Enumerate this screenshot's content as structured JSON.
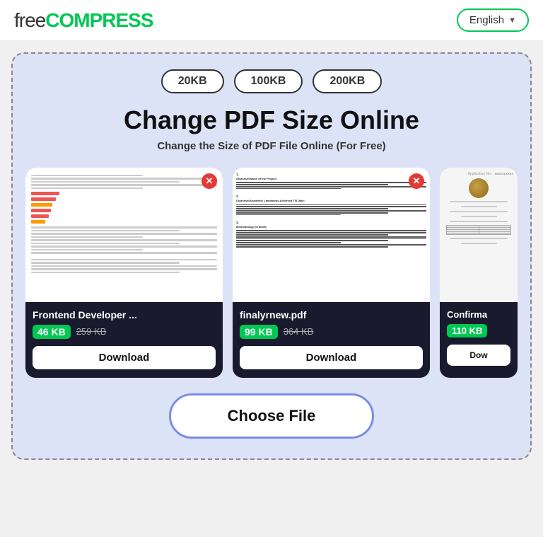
{
  "header": {
    "logo_free": "free",
    "logo_compress": "COMPRESS",
    "lang_label": "English",
    "lang_arrow": "▼"
  },
  "size_pills": [
    "20KB",
    "100KB",
    "200KB"
  ],
  "main_title": "Change PDF Size Online",
  "sub_title": "Change the Size of PDF File Online (For Free)",
  "cards": [
    {
      "filename": "Frontend Developer ...",
      "new_size": "46 KB",
      "old_size": "259 KB",
      "download_label": "Download"
    },
    {
      "filename": "finalyrnew.pdf",
      "new_size": "99 KB",
      "old_size": "364 KB",
      "download_label": "Download"
    },
    {
      "filename": "Confirma",
      "new_size": "110 KB",
      "old_size": "",
      "download_label": "Dow"
    }
  ],
  "choose_file_label": "Choose File"
}
